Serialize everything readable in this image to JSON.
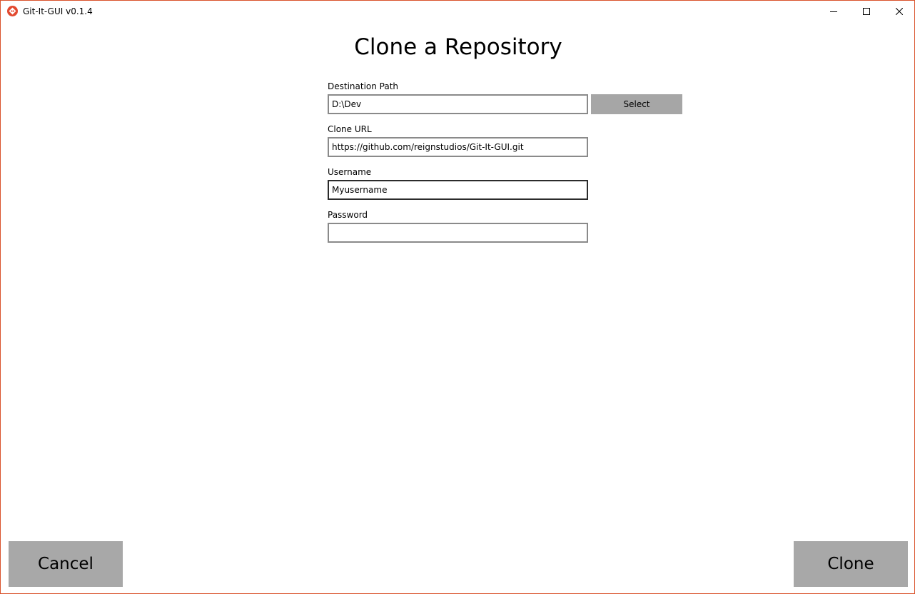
{
  "window": {
    "title": "Git-It-GUI v0.1.4",
    "accent": "#d9532c"
  },
  "page": {
    "title": "Clone a Repository"
  },
  "form": {
    "destination": {
      "label": "Destination Path",
      "value": "D:\\Dev",
      "select_label": "Select"
    },
    "clone_url": {
      "label": "Clone URL",
      "value": "https://github.com/reignstudios/Git-It-GUI.git"
    },
    "username": {
      "label": "Username",
      "value": "Myusername"
    },
    "password": {
      "label": "Password",
      "value": ""
    }
  },
  "footer": {
    "cancel_label": "Cancel",
    "clone_label": "Clone"
  },
  "icons": {
    "app": "git-logo-icon",
    "minimize": "minimize-icon",
    "maximize": "maximize-icon",
    "close": "close-icon"
  }
}
